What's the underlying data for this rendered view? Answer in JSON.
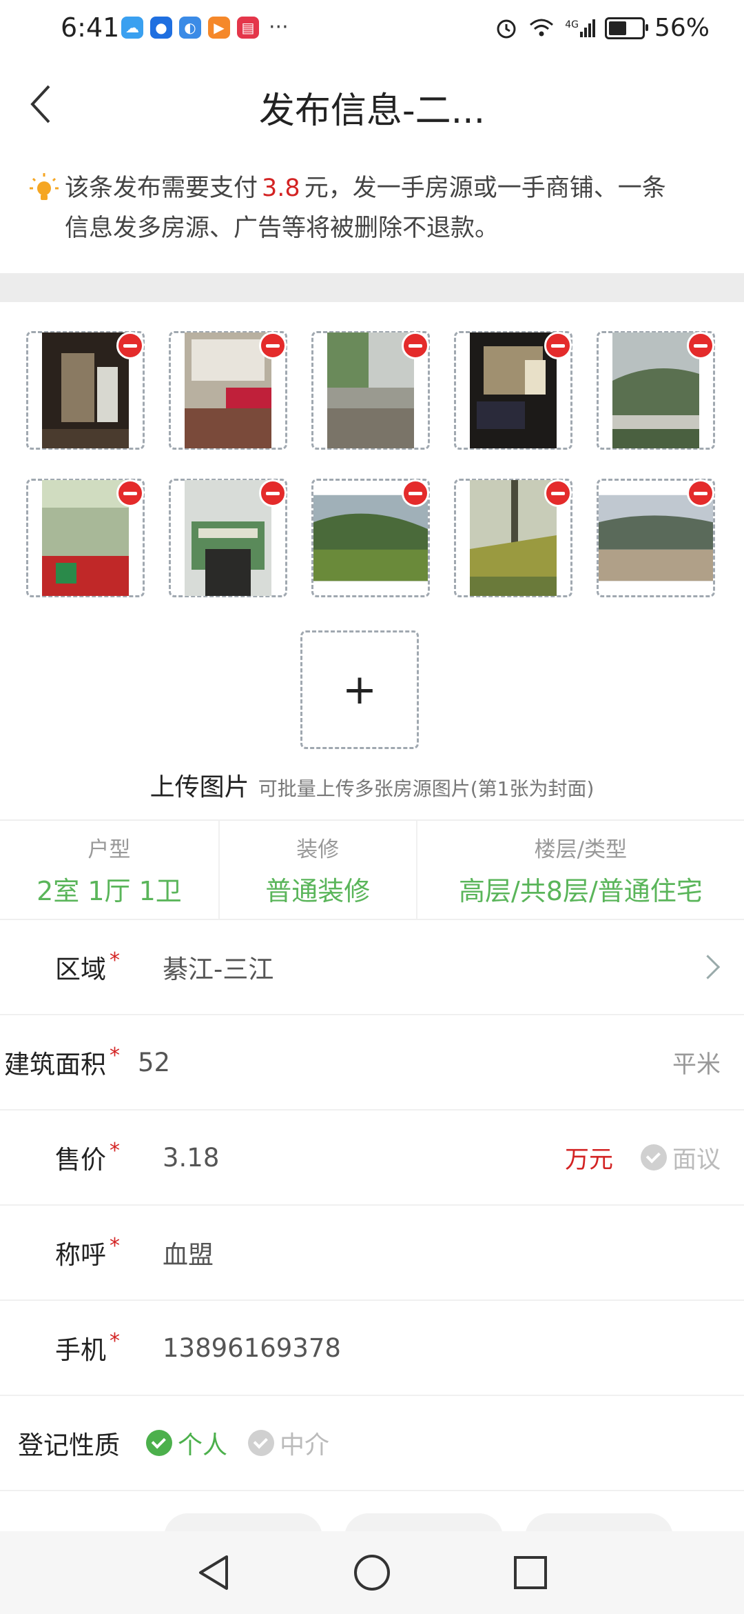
{
  "status_bar": {
    "time": "6:41",
    "more": "···",
    "battery": "56%",
    "battery_level": 0.56,
    "network": "4G"
  },
  "header": {
    "title": "发布信息-二..."
  },
  "notice": {
    "prefix": "该条发布需要支付",
    "price": "3.8",
    "suffix": "元，发一手房源或一手商铺、一条",
    "line2": "信息发多房源、广告等将被删除不退款。"
  },
  "photos": {
    "add_label": "+",
    "upload_title": "上传图片",
    "upload_sub": "可批量上传多张房源图片(第1张为封面)"
  },
  "summary": [
    {
      "label": "户型",
      "value": "2室 1厅 1卫"
    },
    {
      "label": "装修",
      "value": "普通装修"
    },
    {
      "label": "楼层/类型",
      "value": "高层/共8层/普通住宅"
    }
  ],
  "form": {
    "region": {
      "label": "区域",
      "value": "綦江-三江"
    },
    "area": {
      "label": "建筑面积",
      "value": "52",
      "unit": "平米"
    },
    "price": {
      "label": "售价",
      "value": "3.18",
      "unit": "万元",
      "negotiable": "面议"
    },
    "name": {
      "label": "称呼",
      "value": "血盟"
    },
    "phone": {
      "label": "手机",
      "value": "13896169378"
    },
    "nature": {
      "label": "登记性质",
      "option_personal": "个人",
      "option_agent": "中介"
    },
    "required_mark": "*"
  },
  "colors": {
    "accent_green": "#5ab55a",
    "price_red": "#d32323",
    "remove_red": "#e42b2b"
  }
}
